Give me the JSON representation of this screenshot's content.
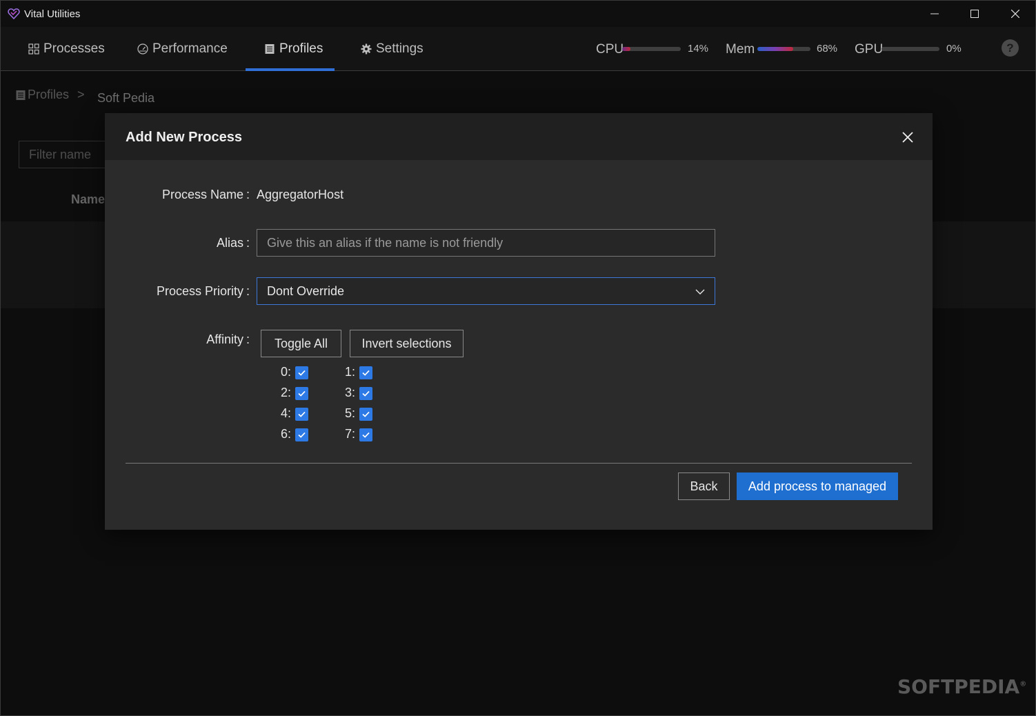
{
  "window": {
    "title": "Vital Utilities",
    "minimize_glyph": "—",
    "close_glyph": "✕"
  },
  "nav": {
    "tabs": [
      {
        "label": "Processes",
        "icon": "grid-icon"
      },
      {
        "label": "Performance",
        "icon": "gauge-icon"
      },
      {
        "label": "Profiles",
        "icon": "list-icon",
        "active": true
      },
      {
        "label": "Settings",
        "icon": "gear-icon"
      }
    ],
    "meters": [
      {
        "label": "CPU",
        "value": "14%",
        "fraction": 0.14
      },
      {
        "label": "Mem",
        "value": "68%",
        "fraction": 0.68
      },
      {
        "label": "GPU",
        "value": "0%",
        "fraction": 0.0
      }
    ],
    "help": "?"
  },
  "breadcrumb": {
    "root": "Profiles",
    "separator": ">",
    "current": "Soft Pedia"
  },
  "page": {
    "filter_placeholder": "Filter name",
    "column_name": "Name"
  },
  "dialog": {
    "title": "Add New Process",
    "process_name_label": "Process Name",
    "process_name_value": "AggregatorHost",
    "alias_label": "Alias",
    "alias_placeholder": "Give this an alias if the name is not friendly",
    "priority_label": "Process Priority",
    "priority_value": "Dont Override",
    "affinity_label": "Affinity",
    "toggle_all": "Toggle All",
    "invert_selections": "Invert selections",
    "cores": [
      {
        "label": "0:",
        "checked": true
      },
      {
        "label": "1:",
        "checked": true
      },
      {
        "label": "2:",
        "checked": true
      },
      {
        "label": "3:",
        "checked": true
      },
      {
        "label": "4:",
        "checked": true
      },
      {
        "label": "5:",
        "checked": true
      },
      {
        "label": "6:",
        "checked": true
      },
      {
        "label": "7:",
        "checked": true
      }
    ],
    "back": "Back",
    "submit": "Add process to managed",
    "colon": ":"
  },
  "watermark": "SOFTPEDIA",
  "colors": {
    "accent": "#1f6fd1",
    "checkbox": "#2d7ae6",
    "tab_underline": "#2f6fd6"
  }
}
